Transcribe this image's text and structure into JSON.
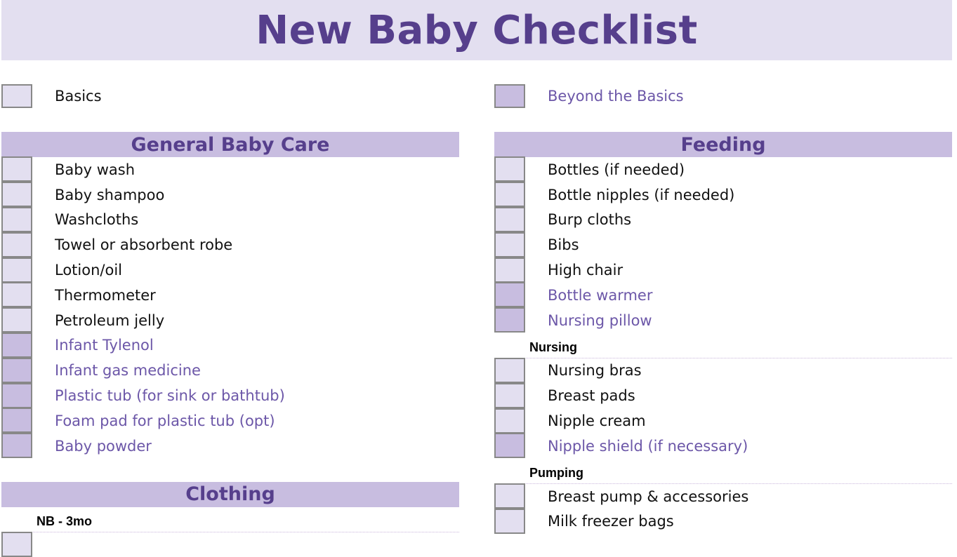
{
  "title": "New Baby Checklist",
  "legend": {
    "basics": "Basics",
    "beyond": "Beyond the Basics"
  },
  "colors": {
    "title_bg": "#e3dff0",
    "header_bg": "#c8bde0",
    "title_text": "#563f8c",
    "beyond_text": "#6c57a8"
  },
  "left": {
    "general": {
      "header": "General Baby Care",
      "items": [
        {
          "label": "Baby wash",
          "type": "basic"
        },
        {
          "label": "Baby shampoo",
          "type": "basic"
        },
        {
          "label": "Washcloths",
          "type": "basic"
        },
        {
          "label": "Towel or absorbent robe",
          "type": "basic"
        },
        {
          "label": "Lotion/oil",
          "type": "basic"
        },
        {
          "label": "Thermometer",
          "type": "basic"
        },
        {
          "label": "Petroleum jelly",
          "type": "basic"
        },
        {
          "label": "Infant Tylenol",
          "type": "beyond"
        },
        {
          "label": "Infant gas medicine",
          "type": "beyond"
        },
        {
          "label": "Plastic tub (for sink or bathtub)",
          "type": "beyond"
        },
        {
          "label": "Foam pad for plastic tub (opt)",
          "type": "beyond"
        },
        {
          "label": "Baby powder",
          "type": "beyond"
        }
      ]
    },
    "clothing": {
      "header": "Clothing",
      "subheader": "NB - 3mo"
    }
  },
  "right": {
    "feeding": {
      "header": "Feeding",
      "items": [
        {
          "label": "Bottles (if needed)",
          "type": "basic"
        },
        {
          "label": "Bottle nipples (if needed)",
          "type": "basic"
        },
        {
          "label": "Burp cloths",
          "type": "basic"
        },
        {
          "label": "Bibs",
          "type": "basic"
        },
        {
          "label": "High chair",
          "type": "basic"
        },
        {
          "label": "Bottle warmer",
          "type": "beyond"
        },
        {
          "label": "Nursing pillow",
          "type": "beyond"
        }
      ]
    },
    "nursing": {
      "subheader": "Nursing",
      "items": [
        {
          "label": "Nursing bras",
          "type": "basic"
        },
        {
          "label": "Breast pads",
          "type": "basic"
        },
        {
          "label": "Nipple cream",
          "type": "basic"
        },
        {
          "label": "Nipple shield (if necessary)",
          "type": "beyond"
        }
      ]
    },
    "pumping": {
      "subheader": "Pumping",
      "items": [
        {
          "label": "Breast pump & accessories",
          "type": "basic"
        },
        {
          "label": "Milk freezer bags",
          "type": "basic"
        }
      ]
    }
  }
}
